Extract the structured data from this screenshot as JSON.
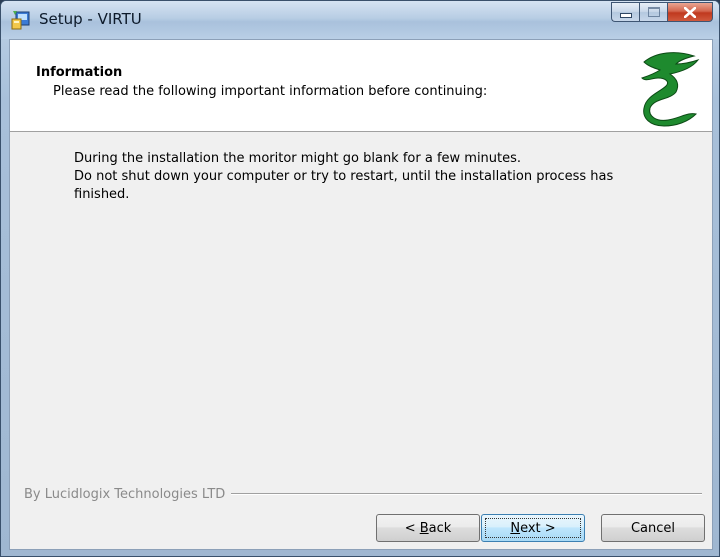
{
  "window": {
    "title": "Setup - VIRTU",
    "caption": {
      "minimize": "minimize",
      "maximize": "maximize",
      "close": "x"
    }
  },
  "header": {
    "title": "Information",
    "subtitle": "Please read the following important information before continuing:"
  },
  "body": {
    "lines": [
      "During the installation the moritor might go blank for a few minutes.",
      "Do not shut down your computer or try to restart, until the installation process has",
      "finished."
    ]
  },
  "footer": {
    "brand": "By Lucidlogix Technologies LTD"
  },
  "buttons": {
    "back": {
      "mnemonic": "B",
      "rest": "ack",
      "prefix": "< "
    },
    "next": {
      "mnemonic": "N",
      "rest": "ext >"
    },
    "cancel": "Cancel"
  },
  "colors": {
    "accent": "#3c7fb1",
    "close": "#c0391f",
    "logo": "#1e8a2e"
  }
}
